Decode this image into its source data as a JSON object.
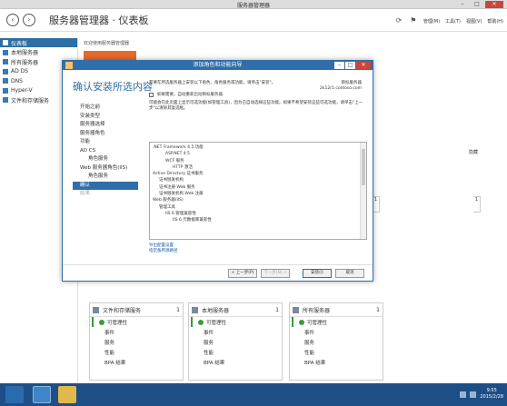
{
  "window": {
    "title": "服务器管理器",
    "controls": [
      "–",
      "□",
      "✕"
    ]
  },
  "header": {
    "title": "服务器管理器 · 仪表板",
    "back": "‹",
    "forward": "›",
    "refresh": "⟳",
    "flag": "⚑",
    "menus": [
      "管理(M)",
      "工具(T)",
      "视图(V)",
      "帮助(H)"
    ]
  },
  "sidebar": {
    "items": [
      {
        "label": "仪表板",
        "active": true
      },
      {
        "label": "本地服务器"
      },
      {
        "label": "所有服务器"
      },
      {
        "label": "AD DS"
      },
      {
        "label": "DNS"
      },
      {
        "label": "Hyper-V"
      },
      {
        "label": "文件和存储服务"
      }
    ]
  },
  "dashboard": {
    "welcome": "欢迎使用服务器管理器",
    "hide": "隐藏",
    "tile_counts": [
      "1",
      "1"
    ],
    "tiles": [
      {
        "title": "文件和存储服务",
        "count": "1",
        "rows": [
          "可管理性",
          "事件",
          "服务",
          "性能",
          "BPA 结果"
        ]
      },
      {
        "title": "本地服务器",
        "count": "1",
        "rows": [
          "可管理性",
          "事件",
          "服务",
          "性能",
          "BPA 结果"
        ]
      },
      {
        "title": "所有服务器",
        "count": "1",
        "rows": [
          "可管理性",
          "事件",
          "服务",
          "性能",
          "BPA 结果"
        ]
      }
    ]
  },
  "wizard": {
    "title": "添加角色和功能向导",
    "heading": "确认安装所选内容",
    "server_label": "目标服务器",
    "server_name": "2k12r1.contoso.com",
    "steps": [
      {
        "label": "开始之前"
      },
      {
        "label": "安装类型"
      },
      {
        "label": "服务器选择"
      },
      {
        "label": "服务器角色"
      },
      {
        "label": "功能"
      },
      {
        "label": "AD CS"
      },
      {
        "label": "角色服务",
        "indent": true
      },
      {
        "label": "Web 服务器角色(IIS)"
      },
      {
        "label": "角色服务",
        "indent": true
      },
      {
        "label": "确认",
        "active": true
      },
      {
        "label": "结果",
        "disabled": true
      }
    ],
    "description": "若要在所选服务器上安装以下角色、角色服务或功能，请单击\"安装\"。",
    "checkbox_label": "如果需要，自动重新启动目标服务器",
    "note": "可能会在此页面上显示可选功能(如管理工具)，因为已自动选择这些功能。如果不希望安装这些可选功能，请单击\"上一步\"以清除其复选框。",
    "features": [
      {
        "label": ".NET Framework 4.5 功能",
        "level": 0
      },
      {
        "label": "ASP.NET 4.5",
        "level": 2
      },
      {
        "label": "WCF 服务",
        "level": 2
      },
      {
        "label": "HTTP 激活",
        "level": 3
      },
      {
        "label": "Active Directory 证书服务",
        "level": 0
      },
      {
        "label": "证书颁发机构",
        "level": 1
      },
      {
        "label": "证书注册 Web 服务",
        "level": 1
      },
      {
        "label": "证书颁发机构 Web 注册",
        "level": 1
      },
      {
        "label": "Web 服务器(IIS)",
        "level": 0
      },
      {
        "label": "管理工具",
        "level": 1
      },
      {
        "label": "IIS 6 管理兼容性",
        "level": 2
      },
      {
        "label": "IIS 6 元数据库兼容性",
        "level": 3
      }
    ],
    "links": [
      "导出配置设置",
      "指定备用源路径"
    ],
    "buttons": {
      "prev": "< 上一步(P)",
      "next": "下一步(N) >",
      "install": "安装(I)",
      "cancel": "取消"
    }
  },
  "taskbar": {
    "time": "9:55",
    "date": "2015/2/28"
  }
}
